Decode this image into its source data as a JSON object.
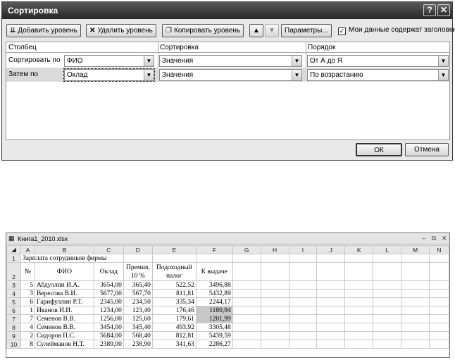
{
  "dialog": {
    "title": "Сортировка",
    "help_icon": "?",
    "close_icon": "✕",
    "toolbar": {
      "add_level": "Добавить уровень",
      "delete_level": "Удалить уровень",
      "copy_level": "Копировать уровень",
      "up_icon": "▲",
      "down_icon": "▼",
      "options": "Параметры...",
      "headers_checkbox": "Мои данные содержат заголовки",
      "headers_checked": "✓"
    },
    "columns": {
      "col": "Столбец",
      "sort": "Сортировка",
      "order": "Порядок"
    },
    "rows": [
      {
        "label": "Сортировать по",
        "column": "ФИО",
        "sort_on": "Значения",
        "order": "От А до Я"
      },
      {
        "label": "Затем по",
        "column": "Оклад",
        "sort_on": "Значения",
        "order": "По возрастанию"
      }
    ],
    "ok": "ОК",
    "cancel": "Отмена"
  },
  "workbook": {
    "title": "Книга1_2010.xlsx",
    "col_headers": [
      "A",
      "B",
      "C",
      "D",
      "E",
      "F",
      "G",
      "H",
      "I",
      "J",
      "K",
      "L",
      "M",
      "N"
    ],
    "row1_title": "Зарплата сотрудников фирмы",
    "header": {
      "no": "№",
      "fio": "ФИО",
      "salary": "Оклад",
      "bonus1": "Премия,",
      "bonus2": "10 %",
      "tax1": "Подоходный",
      "tax2": "налог",
      "pay": "К выдаче"
    },
    "rows": [
      {
        "r": "3",
        "no": "5",
        "fio": "Абдуллин И.А.",
        "salary": "3654,00",
        "bonus": "365,40",
        "tax": "522,52",
        "pay": "3496,88"
      },
      {
        "r": "4",
        "no": "3",
        "fio": "Вересова В.И.",
        "salary": "5677,00",
        "bonus": "567,70",
        "tax": "811,81",
        "pay": "5432,89"
      },
      {
        "r": "5",
        "no": "6",
        "fio": "Гарифуллин Р.Т.",
        "salary": "2345,00",
        "bonus": "234,50",
        "tax": "335,34",
        "pay": "2244,17"
      },
      {
        "r": "6",
        "no": "1",
        "fio": "Иванов И.И.",
        "salary": "1234,00",
        "bonus": "123,40",
        "tax": "176,46",
        "pay": "1180,94"
      },
      {
        "r": "7",
        "no": "7",
        "fio": "Семенов В.В.",
        "salary": "1256,00",
        "bonus": "125,60",
        "tax": "179,61",
        "pay": "1201,99"
      },
      {
        "r": "8",
        "no": "4",
        "fio": "Семенов В.В.",
        "salary": "3454,00",
        "bonus": "345,40",
        "tax": "493,92",
        "pay": "3305,48"
      },
      {
        "r": "9",
        "no": "2",
        "fio": "Сидоров П.С.",
        "salary": "5684,00",
        "bonus": "568,40",
        "tax": "812,81",
        "pay": "5439,59"
      },
      {
        "r": "10",
        "no": "8",
        "fio": "Сулейманов Н.Т.",
        "salary": "2389,00",
        "bonus": "238,90",
        "tax": "341,63",
        "pay": "2286,27"
      }
    ]
  }
}
